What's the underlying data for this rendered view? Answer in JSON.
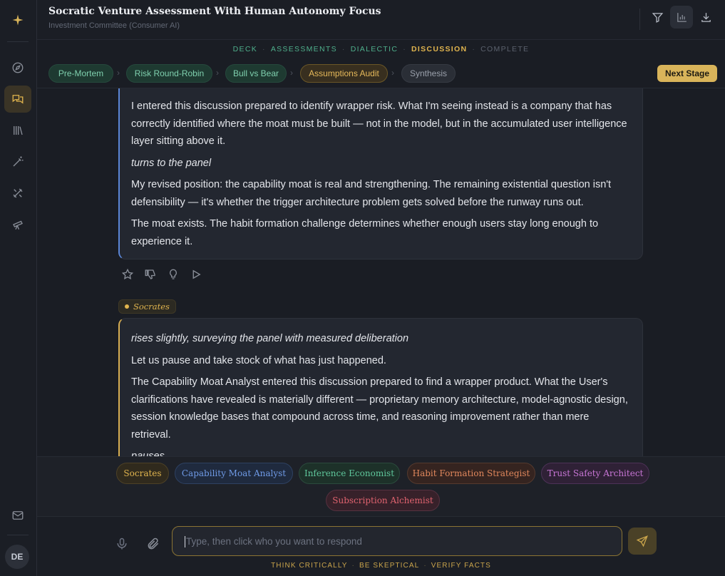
{
  "header": {
    "title": "Socratic Venture Assessment With Human Autonomy Focus",
    "subtitle": "Investment Committee (Consumer AI)"
  },
  "phases": [
    "DECK",
    "ASSESSMENTS",
    "DIALECTIC",
    "DISCUSSION",
    "COMPLETE"
  ],
  "stages": {
    "items": [
      "Pre-Mortem",
      "Risk Round-Robin",
      "Bull vs Bear",
      "Assumptions Audit",
      "Synthesis"
    ],
    "next_label": "Next Stage"
  },
  "messages": [
    {
      "paragraphs": [
        "I entered this discussion prepared to identify wrapper risk. What I'm seeing instead is a company that has correctly identified where the moat must be built — not in the model, but in the accumulated user intelligence layer sitting above it.",
        "turns to the panel",
        "My revised position: the capability moat is real and strengthening. The remaining existential question isn't defensibility — it's whether the trigger architecture problem gets solved before the runway runs out.",
        "The moat exists. The habit formation challenge determines whether enough users stay long enough to experience it."
      ]
    },
    {
      "speaker": "Socrates",
      "paragraphs": [
        "rises slightly, surveying the panel with measured deliberation",
        "Let us pause and take stock of what has just happened.",
        "The Capability Moat Analyst entered this discussion prepared to find a wrapper product. What the User's clarifications have revealed is materially different — proprietary memory architecture, model-agnostic design, session knowledge bases that compound across time, and reasoning improvement rather than mere retrieval.",
        "pauses"
      ]
    }
  ],
  "participants": [
    "Socrates",
    "Capability Moat Analyst",
    "Inference Economist",
    "Habit Formation Strategist",
    "Trust Safety Architect",
    "Subscription Alchemist"
  ],
  "composer": {
    "placeholder": "Type, then click who you want to respond",
    "footer": [
      "THINK CRITICALLY",
      "BE SKEPTICAL",
      "VERIFY FACTS"
    ]
  },
  "user": {
    "initials": "DE"
  },
  "icons": {
    "rail": [
      "sparkle-icon",
      "compass-icon",
      "chat-icon",
      "library-icon",
      "magic-wand-icon",
      "tools-icon",
      "telescope-icon",
      "mail-icon"
    ],
    "header": [
      "filter-icon",
      "bar-chart-icon",
      "download-icon"
    ],
    "message_actions": [
      "star-icon",
      "thumbs-down-icon",
      "lightbulb-icon",
      "play-icon"
    ],
    "composer": [
      "microphone-icon",
      "paperclip-icon",
      "send-icon"
    ]
  },
  "colors": {
    "accent": "#d9b45a",
    "done_stage": "#7fd0ae",
    "socrates": "#e0b44e",
    "capability_moat_analyst": "#6f9ae6",
    "inference_economist": "#5fc79c",
    "habit_formation_strategist": "#e0875c",
    "trust_safety_architect": "#c876d6",
    "subscription_alchemist": "#e0636f"
  }
}
